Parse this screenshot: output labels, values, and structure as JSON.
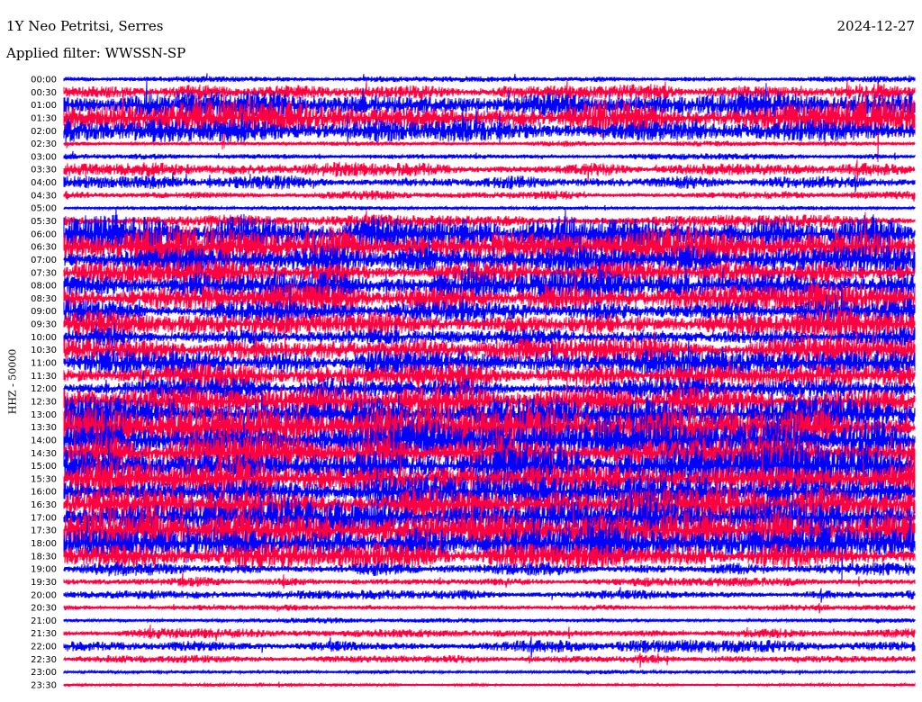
{
  "header": {
    "station": "1Y Neo Petritsi, Serres",
    "date": "2024-12-27",
    "filter": "Applied filter: WWSSN-SP"
  },
  "chart_data": {
    "type": "line",
    "title": "1Y Neo Petritsi, Serres",
    "ylabel": "HHZ - 50000",
    "colors": [
      "#0000ff",
      "#ff0040"
    ],
    "rows": [
      {
        "label": "00:00",
        "amp": 0.1
      },
      {
        "label": "00:30",
        "amp": 0.4
      },
      {
        "label": "01:00",
        "amp": 0.6
      },
      {
        "label": "01:30",
        "amp": 0.9
      },
      {
        "label": "02:00",
        "amp": 0.6
      },
      {
        "label": "02:30",
        "amp": 0.1
      },
      {
        "label": "03:00",
        "amp": 0.1
      },
      {
        "label": "03:30",
        "amp": 0.3
      },
      {
        "label": "04:00",
        "amp": 0.3
      },
      {
        "label": "04:30",
        "amp": 0.2
      },
      {
        "label": "05:00",
        "amp": 0.05
      },
      {
        "label": "05:30",
        "amp": 0.3
      },
      {
        "label": "06:00",
        "amp": 0.9
      },
      {
        "label": "06:30",
        "amp": 1.0
      },
      {
        "label": "07:00",
        "amp": 0.7
      },
      {
        "label": "07:30",
        "amp": 0.6
      },
      {
        "label": "08:00",
        "amp": 0.8
      },
      {
        "label": "08:30",
        "amp": 0.7
      },
      {
        "label": "09:00",
        "amp": 0.6
      },
      {
        "label": "09:30",
        "amp": 0.7
      },
      {
        "label": "10:00",
        "amp": 0.4
      },
      {
        "label": "10:30",
        "amp": 0.6
      },
      {
        "label": "11:00",
        "amp": 0.6
      },
      {
        "label": "11:30",
        "amp": 0.6
      },
      {
        "label": "12:00",
        "amp": 0.5
      },
      {
        "label": "12:30",
        "amp": 0.8
      },
      {
        "label": "13:00",
        "amp": 1.0
      },
      {
        "label": "13:30",
        "amp": 1.0
      },
      {
        "label": "14:00",
        "amp": 1.0
      },
      {
        "label": "14:30",
        "amp": 1.0
      },
      {
        "label": "15:00",
        "amp": 1.0
      },
      {
        "label": "15:30",
        "amp": 1.0
      },
      {
        "label": "16:00",
        "amp": 0.8
      },
      {
        "label": "16:30",
        "amp": 0.9
      },
      {
        "label": "17:00",
        "amp": 1.0
      },
      {
        "label": "17:30",
        "amp": 1.0
      },
      {
        "label": "18:00",
        "amp": 1.0
      },
      {
        "label": "18:30",
        "amp": 0.6
      },
      {
        "label": "19:00",
        "amp": 0.3
      },
      {
        "label": "19:30",
        "amp": 0.2
      },
      {
        "label": "20:00",
        "amp": 0.2
      },
      {
        "label": "20:30",
        "amp": 0.1
      },
      {
        "label": "21:00",
        "amp": 0.1
      },
      {
        "label": "21:30",
        "amp": 0.2
      },
      {
        "label": "22:00",
        "amp": 0.3
      },
      {
        "label": "22:30",
        "amp": 0.15
      },
      {
        "label": "23:00",
        "amp": 0.05
      },
      {
        "label": "23:30",
        "amp": 0.03
      }
    ]
  }
}
